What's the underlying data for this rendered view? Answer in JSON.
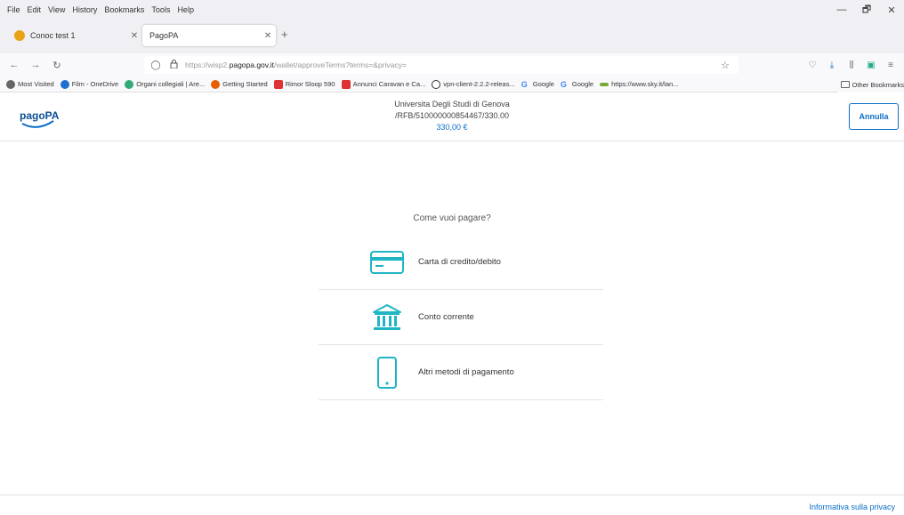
{
  "browser": {
    "menu": [
      "File",
      "Edit",
      "View",
      "History",
      "Bookmarks",
      "Tools",
      "Help"
    ],
    "window_controls": [
      "—",
      "🗗",
      "✕"
    ],
    "tabs": [
      {
        "title": "Conoc test 1",
        "active": false
      },
      {
        "title": "PagoPA",
        "active": true
      }
    ],
    "new_tab_label": "+",
    "url_prefix": "https://wisp2.",
    "url_host": "pagopa.gov.it",
    "url_path": "/wallet/approveTerms?terms=&privacy=",
    "bookmarks": [
      {
        "label": "Most Visited",
        "icon": "gear-icon",
        "color": "#666"
      },
      {
        "label": "Film - OneDrive",
        "icon": "cloud-icon",
        "color": "#1f6fd1"
      },
      {
        "label": "Organi collegiali | Are...",
        "icon": "globe-icon",
        "color": "#3a7"
      },
      {
        "label": "Getting Started",
        "icon": "firefox-icon",
        "color": "#e66000"
      },
      {
        "label": "Rimor Sloop 590",
        "icon": "site-icon",
        "color": "#d33"
      },
      {
        "label": "Annunci Caravan e Ca...",
        "icon": "site-icon",
        "color": "#d33"
      },
      {
        "label": "vpn-client-2.2.2-releas...",
        "icon": "github-icon",
        "color": "#333"
      },
      {
        "label": "Google",
        "icon": "google-icon",
        "color": "#4285f4"
      },
      {
        "label": "Google",
        "icon": "google-icon",
        "color": "#4285f4"
      },
      {
        "label": "https://www.sky.it/lan...",
        "icon": "sky-icon",
        "color": "#7a3"
      }
    ],
    "other_bookmarks": "Other Bookmarks"
  },
  "header": {
    "logo_text": "pagoPA",
    "creditor": "Universita Degli Studi di Genova",
    "reference": "/RFB/510000000854467/330.00",
    "amount": "330,00 €",
    "cancel_label": "Annulla"
  },
  "main": {
    "question": "Come vuoi pagare?",
    "methods": [
      {
        "label": "Carta di credito/debito",
        "icon": "credit-card-icon"
      },
      {
        "label": "Conto corrente",
        "icon": "bank-icon"
      },
      {
        "label": "Altri metodi di pagamento",
        "icon": "smartphone-icon"
      }
    ]
  },
  "footer": {
    "privacy_link": "Informativa sulla privacy"
  },
  "colors": {
    "accent": "#0b6ec8",
    "icon_teal": "#1fb5c4"
  }
}
